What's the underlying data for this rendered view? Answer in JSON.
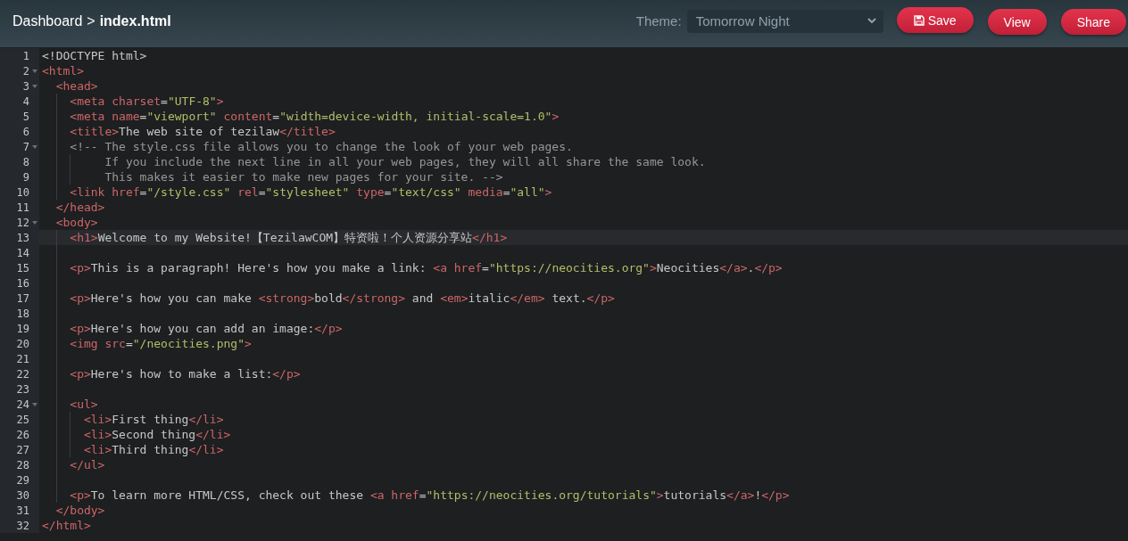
{
  "breadcrumb": {
    "parent": "Dashboard",
    "separator": ">",
    "current": "index.html"
  },
  "theme": {
    "label": "Theme:",
    "value": "Tomorrow Night"
  },
  "buttons": [
    {
      "label": "Save",
      "kind": "save"
    },
    {
      "label": "View",
      "kind": "plain"
    },
    {
      "label": "Share",
      "kind": "plain"
    }
  ],
  "editor": {
    "lines": [
      {
        "number": "1",
        "foldable": false,
        "active": false,
        "tokens": [
          {
            "kind": "text",
            "text": "<!DOCTYPE html>"
          }
        ]
      },
      {
        "number": "2",
        "foldable": true,
        "active": false,
        "tokens": [
          {
            "kind": "tag",
            "text": "<html>"
          }
        ],
        "children": [
          {
            "number": "3",
            "foldable": true,
            "active": false,
            "tokens": [
              {
                "kind": "tag",
                "text": "<head>"
              }
            ],
            "children": [
              {
                "number": "4",
                "foldable": false,
                "active": false,
                "tokens": [
                  {
                    "kind": "tag",
                    "text": "<meta"
                  },
                  {
                    "kind": "attr",
                    "text": " charset"
                  },
                  {
                    "kind": "text",
                    "text": "="
                  },
                  {
                    "kind": "str",
                    "text": "\"UTF-8\""
                  },
                  {
                    "kind": "tag",
                    "text": ">"
                  }
                ]
              },
              {
                "number": "5",
                "foldable": false,
                "active": false,
                "tokens": [
                  {
                    "kind": "tag",
                    "text": "<meta"
                  },
                  {
                    "kind": "attr",
                    "text": " name"
                  },
                  {
                    "kind": "text",
                    "text": "="
                  },
                  {
                    "kind": "str",
                    "text": "\"viewport\""
                  },
                  {
                    "kind": "attr",
                    "text": " content"
                  },
                  {
                    "kind": "text",
                    "text": "="
                  },
                  {
                    "kind": "str",
                    "text": "\"width=device-width, initial-scale=1.0\""
                  },
                  {
                    "kind": "tag",
                    "text": ">"
                  }
                ]
              },
              {
                "number": "6",
                "foldable": false,
                "active": false,
                "tokens": [
                  {
                    "kind": "tag",
                    "text": "<title>"
                  },
                  {
                    "kind": "text",
                    "text": "The web site of tezilaw"
                  },
                  {
                    "kind": "tag",
                    "text": "</title>"
                  }
                ]
              },
              {
                "number": "7",
                "foldable": true,
                "active": false,
                "tokens": [
                  {
                    "kind": "comment",
                    "text": "<!-- The style.css file allows you to change the look of your web pages."
                  }
                ],
                "children": [
                  {
                    "number": "8",
                    "foldable": false,
                    "active": false,
                    "tokens": [
                      {
                        "kind": "comment",
                        "text": "   If you include the next line in all your web pages, they will all share the same look."
                      }
                    ]
                  },
                  {
                    "number": "9",
                    "foldable": false,
                    "active": false,
                    "tokens": [
                      {
                        "kind": "comment",
                        "text": "   This makes it easier to make new pages for your site. -->"
                      }
                    ]
                  }
                ]
              },
              {
                "number": "10",
                "foldable": false,
                "active": false,
                "tokens": [
                  {
                    "kind": "tag",
                    "text": "<link"
                  },
                  {
                    "kind": "attr",
                    "text": " href"
                  },
                  {
                    "kind": "text",
                    "text": "="
                  },
                  {
                    "kind": "str",
                    "text": "\"/style.css\""
                  },
                  {
                    "kind": "attr",
                    "text": " rel"
                  },
                  {
                    "kind": "text",
                    "text": "="
                  },
                  {
                    "kind": "str",
                    "text": "\"stylesheet\""
                  },
                  {
                    "kind": "attr",
                    "text": " type"
                  },
                  {
                    "kind": "text",
                    "text": "="
                  },
                  {
                    "kind": "str",
                    "text": "\"text/css\""
                  },
                  {
                    "kind": "attr",
                    "text": " media"
                  },
                  {
                    "kind": "text",
                    "text": "="
                  },
                  {
                    "kind": "str",
                    "text": "\"all\""
                  },
                  {
                    "kind": "tag",
                    "text": ">"
                  }
                ]
              }
            ]
          },
          {
            "number": "11",
            "foldable": false,
            "active": false,
            "tokens": [
              {
                "kind": "tag",
                "text": "</head>"
              }
            ]
          },
          {
            "number": "12",
            "foldable": true,
            "active": false,
            "tokens": [
              {
                "kind": "tag",
                "text": "<body>"
              }
            ],
            "children": [
              {
                "number": "13",
                "foldable": false,
                "active": true,
                "tokens": [
                  {
                    "kind": "tag",
                    "text": "<h1>"
                  },
                  {
                    "kind": "text",
                    "text": "Welcome to my Website!【TezilawCOM】特资啦！个人资源分享站"
                  },
                  {
                    "kind": "tag",
                    "text": "</h1>"
                  }
                ]
              },
              {
                "number": "14",
                "foldable": false,
                "active": false
              },
              {
                "number": "15",
                "foldable": false,
                "active": false,
                "tokens": [
                  {
                    "kind": "tag",
                    "text": "<p>"
                  },
                  {
                    "kind": "text",
                    "text": "This is a paragraph! Here's how you make a link: "
                  },
                  {
                    "kind": "tag",
                    "text": "<a"
                  },
                  {
                    "kind": "attr",
                    "text": " href"
                  },
                  {
                    "kind": "text",
                    "text": "="
                  },
                  {
                    "kind": "str",
                    "text": "\"https://neocities.org\""
                  },
                  {
                    "kind": "tag",
                    "text": ">"
                  },
                  {
                    "kind": "text",
                    "text": "Neocities"
                  },
                  {
                    "kind": "tag",
                    "text": "</a>"
                  },
                  {
                    "kind": "text",
                    "text": "."
                  },
                  {
                    "kind": "tag",
                    "text": "</p>"
                  }
                ]
              },
              {
                "number": "16",
                "foldable": false,
                "active": false
              },
              {
                "number": "17",
                "foldable": false,
                "active": false,
                "tokens": [
                  {
                    "kind": "tag",
                    "text": "<p>"
                  },
                  {
                    "kind": "text",
                    "text": "Here's how you can make "
                  },
                  {
                    "kind": "tag",
                    "text": "<strong>"
                  },
                  {
                    "kind": "text",
                    "text": "bold"
                  },
                  {
                    "kind": "tag",
                    "text": "</strong>"
                  },
                  {
                    "kind": "text",
                    "text": " and "
                  },
                  {
                    "kind": "tag",
                    "text": "<em>"
                  },
                  {
                    "kind": "text",
                    "text": "italic"
                  },
                  {
                    "kind": "tag",
                    "text": "</em>"
                  },
                  {
                    "kind": "text",
                    "text": " text."
                  },
                  {
                    "kind": "tag",
                    "text": "</p>"
                  }
                ]
              },
              {
                "number": "18",
                "foldable": false,
                "active": false
              },
              {
                "number": "19",
                "foldable": false,
                "active": false,
                "tokens": [
                  {
                    "kind": "tag",
                    "text": "<p>"
                  },
                  {
                    "kind": "text",
                    "text": "Here's how you can add an image:"
                  },
                  {
                    "kind": "tag",
                    "text": "</p>"
                  }
                ]
              },
              {
                "number": "20",
                "foldable": false,
                "active": false,
                "tokens": [
                  {
                    "kind": "tag",
                    "text": "<img"
                  },
                  {
                    "kind": "attr",
                    "text": " src"
                  },
                  {
                    "kind": "text",
                    "text": "="
                  },
                  {
                    "kind": "str",
                    "text": "\"/neocities.png\""
                  },
                  {
                    "kind": "tag",
                    "text": ">"
                  }
                ]
              },
              {
                "number": "21",
                "foldable": false,
                "active": false
              },
              {
                "number": "22",
                "foldable": false,
                "active": false,
                "tokens": [
                  {
                    "kind": "tag",
                    "text": "<p>"
                  },
                  {
                    "kind": "text",
                    "text": "Here's how to make a list:"
                  },
                  {
                    "kind": "tag",
                    "text": "</p>"
                  }
                ]
              },
              {
                "number": "23",
                "foldable": false,
                "active": false
              },
              {
                "number": "24",
                "foldable": true,
                "active": false,
                "tokens": [
                  {
                    "kind": "tag",
                    "text": "<ul>"
                  }
                ],
                "children": [
                  {
                    "number": "25",
                    "foldable": false,
                    "active": false,
                    "tokens": [
                      {
                        "kind": "tag",
                        "text": "<li>"
                      },
                      {
                        "kind": "text",
                        "text": "First thing"
                      },
                      {
                        "kind": "tag",
                        "text": "</li>"
                      }
                    ]
                  },
                  {
                    "number": "26",
                    "foldable": false,
                    "active": false,
                    "tokens": [
                      {
                        "kind": "tag",
                        "text": "<li>"
                      },
                      {
                        "kind": "text",
                        "text": "Second thing"
                      },
                      {
                        "kind": "tag",
                        "text": "</li>"
                      }
                    ]
                  },
                  {
                    "number": "27",
                    "foldable": false,
                    "active": false,
                    "tokens": [
                      {
                        "kind": "tag",
                        "text": "<li>"
                      },
                      {
                        "kind": "text",
                        "text": "Third thing"
                      },
                      {
                        "kind": "tag",
                        "text": "</li>"
                      }
                    ]
                  }
                ]
              },
              {
                "number": "28",
                "foldable": false,
                "active": false,
                "tokens": [
                  {
                    "kind": "tag",
                    "text": "</ul>"
                  }
                ]
              },
              {
                "number": "29",
                "foldable": false,
                "active": false
              },
              {
                "number": "30",
                "foldable": false,
                "active": false,
                "tokens": [
                  {
                    "kind": "tag",
                    "text": "<p>"
                  },
                  {
                    "kind": "text",
                    "text": "To learn more HTML/CSS, check out these "
                  },
                  {
                    "kind": "tag",
                    "text": "<a"
                  },
                  {
                    "kind": "attr",
                    "text": " href"
                  },
                  {
                    "kind": "text",
                    "text": "="
                  },
                  {
                    "kind": "str",
                    "text": "\"https://neocities.org/tutorials\""
                  },
                  {
                    "kind": "tag",
                    "text": ">"
                  },
                  {
                    "kind": "text",
                    "text": "tutorials"
                  },
                  {
                    "kind": "tag",
                    "text": "</a>"
                  },
                  {
                    "kind": "text",
                    "text": "!"
                  },
                  {
                    "kind": "tag",
                    "text": "</p>"
                  }
                ]
              }
            ]
          },
          {
            "number": "31",
            "foldable": false,
            "active": false,
            "tokens": [
              {
                "kind": "tag",
                "text": "</body>"
              }
            ]
          }
        ]
      },
      {
        "number": "32",
        "foldable": false,
        "active": false,
        "tokens": [
          {
            "kind": "tag",
            "text": "</html>"
          }
        ]
      }
    ]
  }
}
